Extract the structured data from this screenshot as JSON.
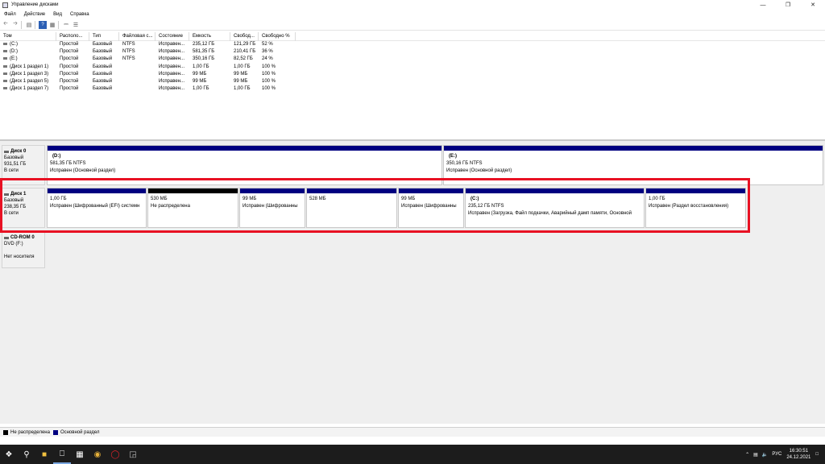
{
  "window": {
    "title": "Управление дисками",
    "controls": [
      "—",
      "❐",
      "✕"
    ]
  },
  "menu": [
    "Файл",
    "Действие",
    "Вид",
    "Справка"
  ],
  "volumes": {
    "headers": [
      "Том",
      "Располо...",
      "Тип",
      "Файловая с...",
      "Состояние",
      "Емкость",
      "Свобод...",
      "Свободно %"
    ],
    "rows": [
      [
        "(C:)",
        "Простой",
        "Базовый",
        "NTFS",
        "Исправен...",
        "235,12 ГБ",
        "121,29 ГБ",
        "52 %"
      ],
      [
        "(D:)",
        "Простой",
        "Базовый",
        "NTFS",
        "Исправен...",
        "581,35 ГБ",
        "210,41 ГБ",
        "36 %"
      ],
      [
        "(E:)",
        "Простой",
        "Базовый",
        "NTFS",
        "Исправен...",
        "350,16 ГБ",
        "82,52 ГБ",
        "24 %"
      ],
      [
        "(Диск 1 раздел 1)",
        "Простой",
        "Базовый",
        "",
        "Исправен...",
        "1,00 ГБ",
        "1,00 ГБ",
        "100 %"
      ],
      [
        "(Диск 1 раздел 3)",
        "Простой",
        "Базовый",
        "",
        "Исправен...",
        "99 МБ",
        "99 МБ",
        "100 %"
      ],
      [
        "(Диск 1 раздел 5)",
        "Простой",
        "Базовый",
        "",
        "Исправен...",
        "99 МБ",
        "99 МБ",
        "100 %"
      ],
      [
        "(Диск 1 раздел 7)",
        "Простой",
        "Базовый",
        "",
        "Исправен...",
        "1,00 ГБ",
        "1,00 ГБ",
        "100 %"
      ]
    ]
  },
  "disk0": {
    "name": "Диск 0",
    "type": "Базовый",
    "size": "931,51 ГБ",
    "status": "В сети",
    "partitions": [
      {
        "name": "(D:)",
        "size": "581,35 ГБ NTFS",
        "status": "Исправен (Основной раздел)"
      },
      {
        "name": "(E:)",
        "size": "350,16 ГБ NTFS",
        "status": "Исправен (Основной раздел)"
      }
    ]
  },
  "disk1": {
    "name": "Диск 1",
    "type": "Базовый",
    "size": "238,35 ГБ",
    "status": "В сети",
    "partitions": [
      {
        "name": "",
        "size": "1,00 ГБ",
        "status": "Исправен (Шифрованный (EFI) системн"
      },
      {
        "name": "",
        "size": "530 МБ",
        "status": "Не распределена"
      },
      {
        "name": "",
        "size": "99 МБ",
        "status": "Исправен (Шифрованны"
      },
      {
        "name": "",
        "size": "528 МБ",
        "status": ""
      },
      {
        "name": "",
        "size": "99 МБ",
        "status": "Исправен (Шифрованны"
      },
      {
        "name": "(C:)",
        "size": "235,12 ГБ NTFS",
        "status": "Исправен (Загрузка, Файл подкачки, Аварийный дамп памяти, Основной"
      },
      {
        "name": "",
        "size": "1,00 ГБ",
        "status": "Исправен (Раздел восстановления)"
      }
    ]
  },
  "cdrom": {
    "name": "CD-ROM 0",
    "type": "DVD (F:)",
    "status": "Нет носителя"
  },
  "legend": {
    "unallocated": "Не распределена",
    "primary": "Основной раздел"
  },
  "colors": {
    "primary": "#000080",
    "unallocated": "#000000",
    "highlight": "#e81123"
  },
  "tray": {
    "lang": "РУС",
    "time": "16:30:51",
    "date": "24.12.2021"
  }
}
